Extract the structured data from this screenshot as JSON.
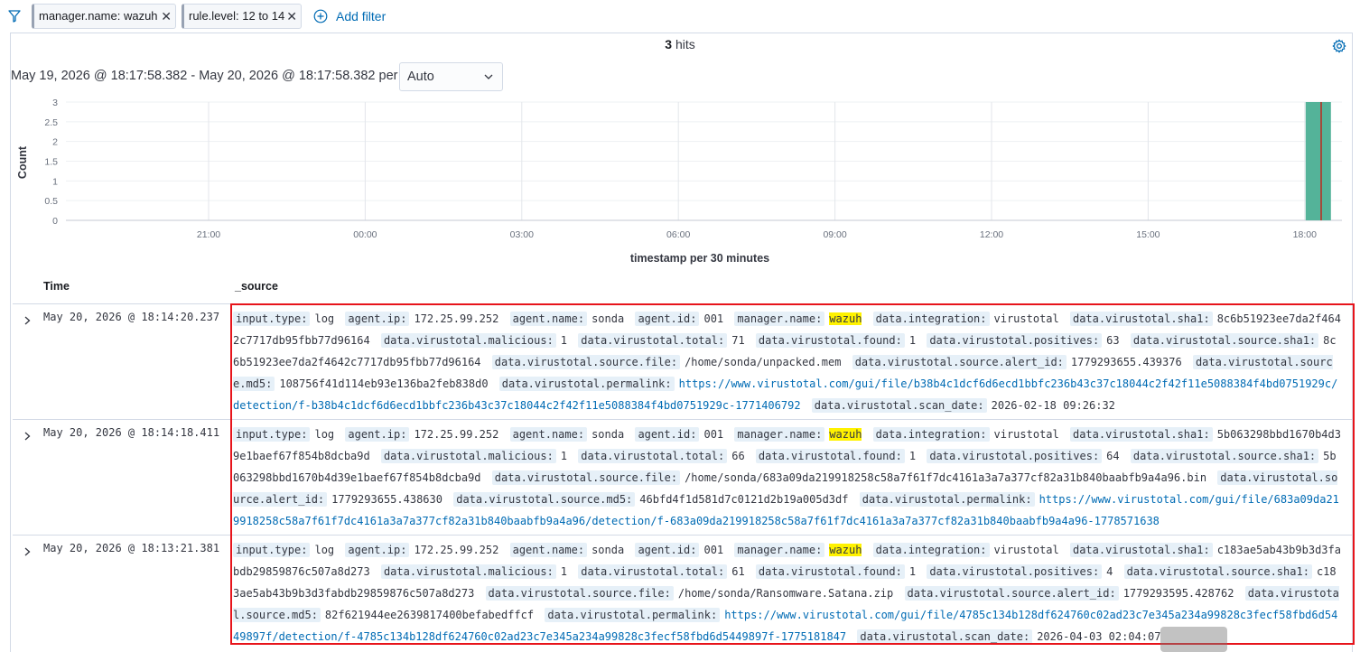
{
  "filters": [
    {
      "label": "manager.name: wazuh"
    },
    {
      "label": "rule.level: 12 to 14"
    }
  ],
  "add_filter_label": "Add filter",
  "hits": {
    "count": "3",
    "label": "hits"
  },
  "time_range": "May 19, 2026 @ 18:17:58.382 - May 20, 2026 @ 18:17:58.382 per",
  "interval": {
    "selected": "Auto"
  },
  "chart_data": {
    "type": "bar",
    "ylabel": "Count",
    "xlabel": "timestamp per 30 minutes",
    "yticks": [
      "0",
      "0.5",
      "1",
      "1.5",
      "2",
      "2.5",
      "3"
    ],
    "ylim": [
      0,
      3
    ],
    "xticks": [
      "21:00",
      "00:00",
      "03:00",
      "06:00",
      "09:00",
      "12:00",
      "15:00",
      "18:00"
    ],
    "x": [
      "18:00"
    ],
    "values": [
      3
    ],
    "bar_color": "#54b399",
    "current_time_marker": "#bd271e",
    "grid": true
  },
  "table": {
    "columns": {
      "time": "Time",
      "source": "_source"
    },
    "rows": [
      {
        "time": "May 20, 2026 @ 18:14:20.237",
        "fields": [
          {
            "k": "input.type:",
            "v": "log"
          },
          {
            "k": "agent.ip:",
            "v": "172.25.99.252"
          },
          {
            "k": "agent.name:",
            "v": "sonda"
          },
          {
            "k": "agent.id:",
            "v": "001"
          },
          {
            "k": "manager.name:",
            "v": "wazuh",
            "highlight": true
          },
          {
            "k": "data.integration:",
            "v": "virustotal"
          },
          {
            "k": "data.virustotal.sha1:",
            "v": "8c6b51923ee7da2f4642c7717db95fbb77d96164"
          },
          {
            "k": "data.virustotal.malicious:",
            "v": "1"
          },
          {
            "k": "data.virustotal.total:",
            "v": "71"
          },
          {
            "k": "data.virustotal.found:",
            "v": "1"
          },
          {
            "k": "data.virustotal.positives:",
            "v": "63"
          },
          {
            "k": "data.virustotal.source.sha1:",
            "v": "8c6b51923ee7da2f4642c7717db95fbb77d96164"
          },
          {
            "k": "data.virustotal.source.file:",
            "v": "/home/sonda/unpacked.mem"
          },
          {
            "k": "data.virustotal.source.alert_id:",
            "v": "1779293655.439376"
          },
          {
            "k": "data.virustotal.source.md5:",
            "v": "108756f41d114eb93e136ba2feb838d0"
          },
          {
            "k": "data.virustotal.permalink:",
            "v": "https://www.virustotal.com/gui/file/b38b4c1dcf6d6ecd1bbfc236b43c37c18044c2f42f11e5088384f4bd0751929c/detection/f-b38b4c1dcf6d6ecd1bbfc236b43c37c18044c2f42f11e5088384f4bd0751929c-1771406792",
            "link": true
          },
          {
            "k": "data.virustotal.scan_date:",
            "v": "2026-02-18 09:26:32"
          }
        ]
      },
      {
        "time": "May 20, 2026 @ 18:14:18.411",
        "fields": [
          {
            "k": "input.type:",
            "v": "log"
          },
          {
            "k": "agent.ip:",
            "v": "172.25.99.252"
          },
          {
            "k": "agent.name:",
            "v": "sonda"
          },
          {
            "k": "agent.id:",
            "v": "001"
          },
          {
            "k": "manager.name:",
            "v": "wazuh",
            "highlight": true
          },
          {
            "k": "data.integration:",
            "v": "virustotal"
          },
          {
            "k": "data.virustotal.sha1:",
            "v": "5b063298bbd1670b4d39e1baef67f854b8dcba9d"
          },
          {
            "k": "data.virustotal.malicious:",
            "v": "1"
          },
          {
            "k": "data.virustotal.total:",
            "v": "66"
          },
          {
            "k": "data.virustotal.found:",
            "v": "1"
          },
          {
            "k": "data.virustotal.positives:",
            "v": "64"
          },
          {
            "k": "data.virustotal.source.sha1:",
            "v": "5b063298bbd1670b4d39e1baef67f854b8dcba9d"
          },
          {
            "k": "data.virustotal.source.file:",
            "v": "/home/sonda/683a09da219918258c58a7f61f7dc4161a3a7a377cf82a31b840baabfb9a4a96.bin"
          },
          {
            "k": "data.virustotal.source.alert_id:",
            "v": "1779293655.438630"
          },
          {
            "k": "data.virustotal.source.md5:",
            "v": "46bfd4f1d581d7c0121d2b19a005d3df"
          },
          {
            "k": "data.virustotal.permalink:",
            "v": "https://www.virustotal.com/gui/file/683a09da219918258c58a7f61f7dc4161a3a7a377cf82a31b840baabfb9a4a96/detection/f-683a09da219918258c58a7f61f7dc4161a3a7a377cf82a31b840baabfb9a4a96-1778571638",
            "link": true
          }
        ]
      },
      {
        "time": "May 20, 2026 @ 18:13:21.381",
        "fields": [
          {
            "k": "input.type:",
            "v": "log"
          },
          {
            "k": "agent.ip:",
            "v": "172.25.99.252"
          },
          {
            "k": "agent.name:",
            "v": "sonda"
          },
          {
            "k": "agent.id:",
            "v": "001"
          },
          {
            "k": "manager.name:",
            "v": "wazuh",
            "highlight": true
          },
          {
            "k": "data.integration:",
            "v": "virustotal"
          },
          {
            "k": "data.virustotal.sha1:",
            "v": "c183ae5ab43b9b3d3fabdb29859876c507a8d273"
          },
          {
            "k": "data.virustotal.malicious:",
            "v": "1"
          },
          {
            "k": "data.virustotal.total:",
            "v": "61"
          },
          {
            "k": "data.virustotal.found:",
            "v": "1"
          },
          {
            "k": "data.virustotal.positives:",
            "v": "4"
          },
          {
            "k": "data.virustotal.source.sha1:",
            "v": "c183ae5ab43b9b3d3fabdb29859876c507a8d273"
          },
          {
            "k": "data.virustotal.source.file:",
            "v": "/home/sonda/Ransomware.Satana.zip"
          },
          {
            "k": "data.virustotal.source.alert_id:",
            "v": "1779293595.428762"
          },
          {
            "k": "data.virustotal.source.md5:",
            "v": "82f621944ee2639817400befabedffcf"
          },
          {
            "k": "data.virustotal.permalink:",
            "v": "https://www.virustotal.com/gui/file/4785c134b128df624760c02ad23c7e345a234a99828c3fecf58fbd6d5449897f/detection/f-4785c134b128df624760c02ad23c7e345a234a99828c3fecf58fbd6d5449897f-1775181847",
            "link": true
          },
          {
            "k": "data.virustotal.scan_date:",
            "v": "2026-04-03 02:04:07"
          }
        ]
      }
    ]
  }
}
